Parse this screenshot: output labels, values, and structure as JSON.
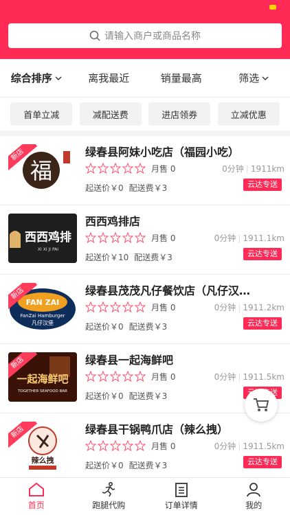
{
  "search": {
    "placeholder": "请输入商户或商品名称"
  },
  "sort": {
    "items": [
      {
        "label": "综合排序"
      },
      {
        "label": "离我最近"
      },
      {
        "label": "销量最高"
      },
      {
        "label": "筛选"
      }
    ]
  },
  "promos": [
    {
      "label": "首单立减"
    },
    {
      "label": "减配送费"
    },
    {
      "label": "进店领券"
    },
    {
      "label": "立减优惠"
    }
  ],
  "stores": [
    {
      "name": "绿春县阿妹小吃店（福园小吃）",
      "sold": "月售 0",
      "time": "0分钟",
      "distance": "1911km",
      "min_order": "起送价￥0",
      "delivery_fee": "配送费￥3",
      "tag": "云达专送",
      "is_new": "新店"
    },
    {
      "name": "西西鸡排店",
      "sold": "月售 0",
      "time": "0分钟",
      "distance": "1911.1km",
      "min_order": "起送价￥10",
      "delivery_fee": "配送费￥3",
      "tag": "云达专送",
      "is_new": ""
    },
    {
      "name": "绿春县茂茂凡仔餐饮店（凡仔汉…",
      "sold": "月售 0",
      "time": "0分钟",
      "distance": "1911.2km",
      "min_order": "起送价￥0",
      "delivery_fee": "配送费￥3",
      "tag": "云达专送",
      "is_new": "新店"
    },
    {
      "name": "绿春县一起海鲜吧",
      "sold": "月售 0",
      "time": "0分钟",
      "distance": "1911.5km",
      "min_order": "起送价￥0",
      "delivery_fee": "配送费￥3",
      "tag": "云达专送",
      "is_new": "新店"
    },
    {
      "name": "绿春县干锅鸭爪店（辣么拽）",
      "sold": "月售 0",
      "time": "0分钟",
      "distance": "1911.5km",
      "min_order": "起送价￥0",
      "delivery_fee": "配送费￥3",
      "tag": "云达专送",
      "is_new": "新店"
    }
  ],
  "thumb_text": {
    "t1": "福",
    "t2_main": "西西鸡排",
    "t2_sub": "XI XI JI PAI",
    "t3_main": "FAN ZAI",
    "t3_sub": "FanZai Hamburger",
    "t3_cn": "凡仔汉堡",
    "t4_main": "一起海鲜吧",
    "t4_sub": "TOGETHER SEAFOOD BAR",
    "t5_main": "辣么拽"
  },
  "tabs": [
    {
      "label": "首页",
      "icon": "home-icon"
    },
    {
      "label": "跑腿代购",
      "icon": "runner-icon"
    },
    {
      "label": "订单详情",
      "icon": "order-icon"
    },
    {
      "label": "我的",
      "icon": "user-icon"
    }
  ],
  "colors": {
    "accent": "#ff2b56",
    "status_dot": "#ffd400"
  }
}
